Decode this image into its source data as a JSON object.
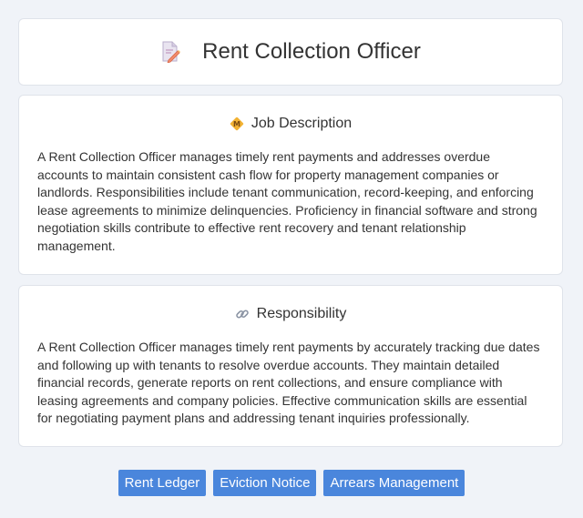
{
  "header": {
    "title": "Rent Collection Officer",
    "icon": "document-pencil-icon"
  },
  "job_description": {
    "heading": "Job Description",
    "icon": "badge-icon",
    "body": "A Rent Collection Officer manages timely rent payments and addresses overdue accounts to maintain consistent cash flow for property management companies or landlords. Responsibilities include tenant communication, record-keeping, and enforcing lease agreements to minimize delinquencies. Proficiency in financial software and strong negotiation skills contribute to effective rent recovery and tenant relationship management."
  },
  "responsibility": {
    "heading": "Responsibility",
    "icon": "link-icon",
    "body": "A Rent Collection Officer manages timely rent payments by accurately tracking due dates and following up with tenants to resolve overdue accounts. They maintain detailed financial records, generate reports on rent collections, and ensure compliance with leasing agreements and company policies. Effective communication skills are essential for negotiating payment plans and addressing tenant inquiries professionally."
  },
  "tags": [
    "Rent Ledger",
    "Eviction Notice",
    "Arrears Management"
  ],
  "colors": {
    "tag_bg": "#4a86dc",
    "page_bg": "#f0f3f8"
  }
}
